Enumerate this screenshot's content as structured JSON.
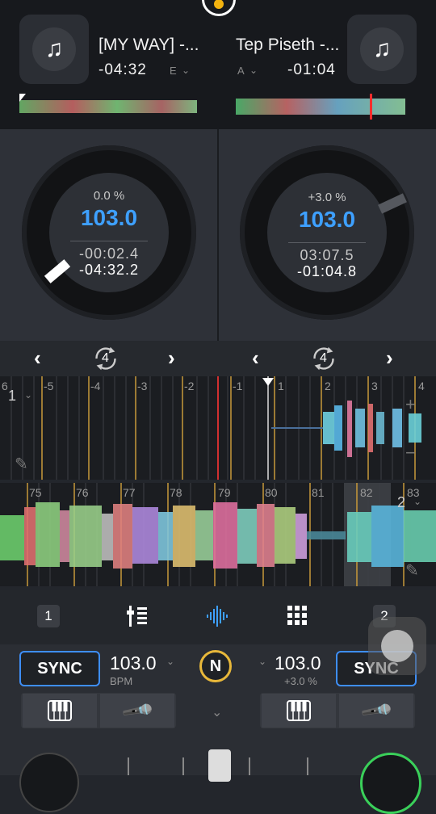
{
  "deckA": {
    "title": "[MY WAY] -...",
    "remaining": "-04:32",
    "key": "E",
    "pitch": "0.0 %",
    "bpm": "103.0",
    "elapsed": "-00:02.4",
    "remain_detail": "-04:32.2"
  },
  "deckB": {
    "title": "Tep Piseth -...",
    "remaining": "-01:04",
    "key": "A",
    "pitch": "+3.0 %",
    "bpm": "103.0",
    "elapsed": "03:07.5",
    "remain_detail": "-01:04.8"
  },
  "loop": {
    "left_size": "4",
    "right_size": "4"
  },
  "wave1": {
    "deck_label": "1",
    "beats": [
      "6",
      "-5",
      "-4",
      "-3",
      "-2",
      "-1",
      "1",
      "2",
      "3",
      "4"
    ]
  },
  "wave2": {
    "deck_label": "2",
    "beats": [
      "75",
      "76",
      "77",
      "78",
      "79",
      "80",
      "81",
      "82",
      "83"
    ]
  },
  "tabbar": {
    "deck1": "1",
    "deck2": "2"
  },
  "controls": {
    "sync_label": "SYNC",
    "left_bpm": "103.0",
    "left_bpm_sub": "BPM",
    "right_bpm": "103.0",
    "right_bpm_sub": "+3.0 %",
    "center_logo": "N"
  },
  "colors": {
    "accent": "#3ea0ff",
    "sync_border": "#3e8ef7",
    "logo_ring": "#e8b83a",
    "playhead": "#ff3b3b"
  }
}
